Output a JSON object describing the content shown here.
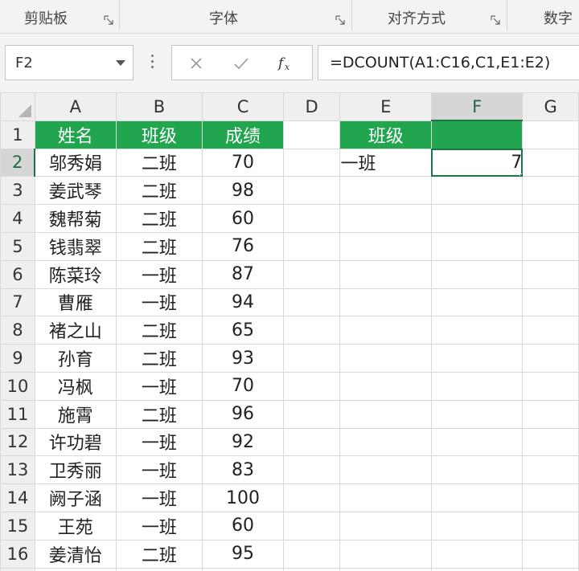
{
  "ribbon": {
    "groups": [
      {
        "label": "剪贴板"
      },
      {
        "label": "字体"
      },
      {
        "label": "对齐方式"
      },
      {
        "label": "数字"
      }
    ]
  },
  "formula_bar": {
    "name_box": "F2",
    "cancel_icon": "close-icon",
    "enter_icon": "check-icon",
    "function_icon": "fx-icon",
    "formula": "=DCOUNT(A1:C16,C1,E1:E2)"
  },
  "sheet": {
    "columns": [
      "A",
      "B",
      "C",
      "D",
      "E",
      "F",
      "G"
    ],
    "selected_column": "F",
    "selected_row": "2",
    "header_color": "#21a54e",
    "selection_color": "#217346",
    "table_headers": [
      "姓名",
      "班级",
      "成绩"
    ],
    "rows": [
      {
        "num": "2",
        "name": "邬秀娟",
        "cls": "二班",
        "score": "70"
      },
      {
        "num": "3",
        "name": "姜武琴",
        "cls": "二班",
        "score": "98"
      },
      {
        "num": "4",
        "name": "魏帮菊",
        "cls": "二班",
        "score": "60"
      },
      {
        "num": "5",
        "name": "钱翡翠",
        "cls": "二班",
        "score": "76"
      },
      {
        "num": "6",
        "name": "陈菜玲",
        "cls": "一班",
        "score": "87"
      },
      {
        "num": "7",
        "name": "曹雁",
        "cls": "一班",
        "score": "94"
      },
      {
        "num": "8",
        "name": "褚之山",
        "cls": "二班",
        "score": "65"
      },
      {
        "num": "9",
        "name": "孙育",
        "cls": "二班",
        "score": "93"
      },
      {
        "num": "10",
        "name": "冯枫",
        "cls": "一班",
        "score": "70"
      },
      {
        "num": "11",
        "name": "施霄",
        "cls": "二班",
        "score": "96"
      },
      {
        "num": "12",
        "name": "许功碧",
        "cls": "一班",
        "score": "92"
      },
      {
        "num": "13",
        "name": "卫秀丽",
        "cls": "一班",
        "score": "83"
      },
      {
        "num": "14",
        "name": "阙子涵",
        "cls": "一班",
        "score": "100"
      },
      {
        "num": "15",
        "name": "王苑",
        "cls": "一班",
        "score": "60"
      },
      {
        "num": "16",
        "name": "姜清怡",
        "cls": "二班",
        "score": "95"
      }
    ],
    "criteria_header": "班级",
    "criteria_value": "一班",
    "result": "7"
  }
}
